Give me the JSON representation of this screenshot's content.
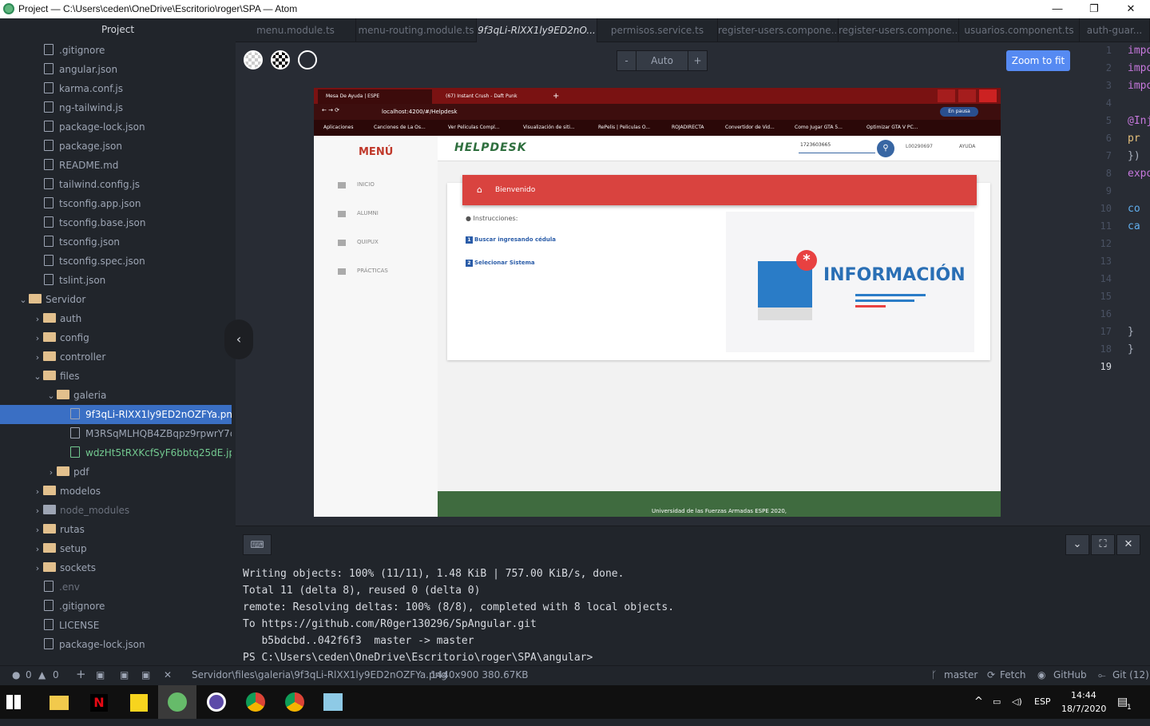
{
  "window": {
    "title": "Project — C:\\Users\\ceden\\OneDrive\\Escritorio\\roger\\SPA — Atom",
    "minimize": "—",
    "restore": "❐",
    "close": "✕"
  },
  "tree": {
    "header": "Project",
    "items": [
      {
        "label": ".gitignore",
        "kind": "file"
      },
      {
        "label": "angular.json",
        "kind": "file"
      },
      {
        "label": "karma.conf.js",
        "kind": "file"
      },
      {
        "label": "ng-tailwind.js",
        "kind": "file"
      },
      {
        "label": "package-lock.json",
        "kind": "file"
      },
      {
        "label": "package.json",
        "kind": "file"
      },
      {
        "label": "README.md",
        "kind": "file"
      },
      {
        "label": "tailwind.config.js",
        "kind": "file"
      },
      {
        "label": "tsconfig.app.json",
        "kind": "file"
      },
      {
        "label": "tsconfig.base.json",
        "kind": "file"
      },
      {
        "label": "tsconfig.json",
        "kind": "file"
      },
      {
        "label": "tsconfig.spec.json",
        "kind": "file"
      },
      {
        "label": "tslint.json",
        "kind": "file"
      },
      {
        "label": "Servidor",
        "kind": "folder-open"
      },
      {
        "label": "auth",
        "kind": "folder"
      },
      {
        "label": "config",
        "kind": "folder"
      },
      {
        "label": "controller",
        "kind": "folder"
      },
      {
        "label": "files",
        "kind": "folder-open"
      },
      {
        "label": "galeria",
        "kind": "folder-open"
      },
      {
        "label": "9f3qLi-RlXX1ly9ED2nOZFYa.png",
        "kind": "image-selected"
      },
      {
        "label": "M3RSqMLHQB4ZBqpz9rpwrY7q.j",
        "kind": "image"
      },
      {
        "label": "wdzHt5tRXKcfSyF6bbtq25dE.jpg",
        "kind": "image-green"
      },
      {
        "label": "pdf",
        "kind": "folder"
      },
      {
        "label": "modelos",
        "kind": "folder"
      },
      {
        "label": "node_modules",
        "kind": "folder-dim"
      },
      {
        "label": "rutas",
        "kind": "folder"
      },
      {
        "label": "setup",
        "kind": "folder"
      },
      {
        "label": "sockets",
        "kind": "folder"
      },
      {
        "label": ".env",
        "kind": "file-dim"
      },
      {
        "label": ".gitignore",
        "kind": "file"
      },
      {
        "label": "LICENSE",
        "kind": "file"
      },
      {
        "label": "package-lock.json",
        "kind": "file"
      }
    ]
  },
  "tabs": [
    "menu.module.ts",
    "menu-routing.module.ts",
    "9f3qLi-RlXX1ly9ED2nO...",
    "permisos.service.ts",
    "register-users.compone...",
    "register-users.compone...",
    "usuarios.component.ts",
    "auth-guar..."
  ],
  "viewer": {
    "zoom_minus": "-",
    "zoom_value": "Auto",
    "zoom_plus": "+",
    "zoom_fit": "Zoom to fit",
    "collapse": "‹"
  },
  "shot": {
    "tab1": "Mesa De Ayuda | ESPE",
    "tab2": "(67) Instant Crush - Daft Punk",
    "tab_new": "+",
    "url": "localhost:4200/#/Helpdesk",
    "paused": "En pausa",
    "bookmarks": [
      "Aplicaciones",
      "Canciones de La Os...",
      "Ver Peliculas Compl...",
      "Visualización de siti...",
      "RePelis | Peliculas O...",
      "ROJADIRECTA",
      "Convertidor de Vid...",
      "Como Jugar GTA 5...",
      "Optimizar GTA V PC..."
    ],
    "menu": "MENÚ",
    "nav": [
      "INICIO",
      "ALUMNI",
      "QUIPUX",
      "PRÁCTICAS"
    ],
    "logo": "HELPDESK",
    "search_value": "1723603665",
    "user": "L00290697",
    "help": "AYUDA",
    "banner": "Bienvenido",
    "instructions": "Instrucciones:",
    "steps": [
      {
        "n": "1",
        "text": "Buscar ingresando cédula"
      },
      {
        "n": "2",
        "text": "Selecionar Sistema"
      }
    ],
    "info_title": "INFORMACIÓN",
    "footer": "Universidad de las Fuerzas Armadas ESPE 2020,"
  },
  "gutter": {
    "lines": [
      "1",
      "2",
      "3",
      "4",
      "5",
      "6",
      "7",
      "8",
      "9",
      "10",
      "11",
      "12",
      "13",
      "14",
      "15",
      "16",
      "17",
      "18",
      "19"
    ],
    "current": "19"
  },
  "code": [
    "impo",
    "impo",
    "impo",
    "",
    "@Inj",
    "  pr",
    "})",
    "expo",
    "",
    "  co",
    "  ca",
    "",
    "",
    "",
    "",
    "",
    "  }",
    "}",
    ""
  ],
  "terminal": {
    "lines": [
      "Writing objects: 100% (11/11), 1.48 KiB | 757.00 KiB/s, done.",
      "Total 11 (delta 8), reused 0 (delta 0)",
      "remote: Resolving deltas: 100% (8/8), completed with 8 local objects.",
      "To https://github.com/R0ger130296/SpAngular.git",
      "   b5bdcbd..042f6f3  master -> master",
      "PS C:\\Users\\ceden\\OneDrive\\Escritorio\\roger\\SPA\\angular>"
    ]
  },
  "status": {
    "errors": "0",
    "warnings": "0",
    "path": "Servidor\\files\\galeria\\9f3qLi-RlXX1ly9ED2nOZFYa.png",
    "image_info": "1440x900 380.67KB",
    "branch": "master",
    "fetch": "Fetch",
    "github": "GitHub",
    "git": "Git (12)"
  },
  "taskbar": {
    "lang": "ESP",
    "time": "14:44",
    "date": "18/7/2020",
    "notif": "1"
  },
  "colors": {
    "accent": "#568af2",
    "selection": "#3a6fc4",
    "brand_red": "#d9433f",
    "brand_green": "#3f6b3f"
  }
}
